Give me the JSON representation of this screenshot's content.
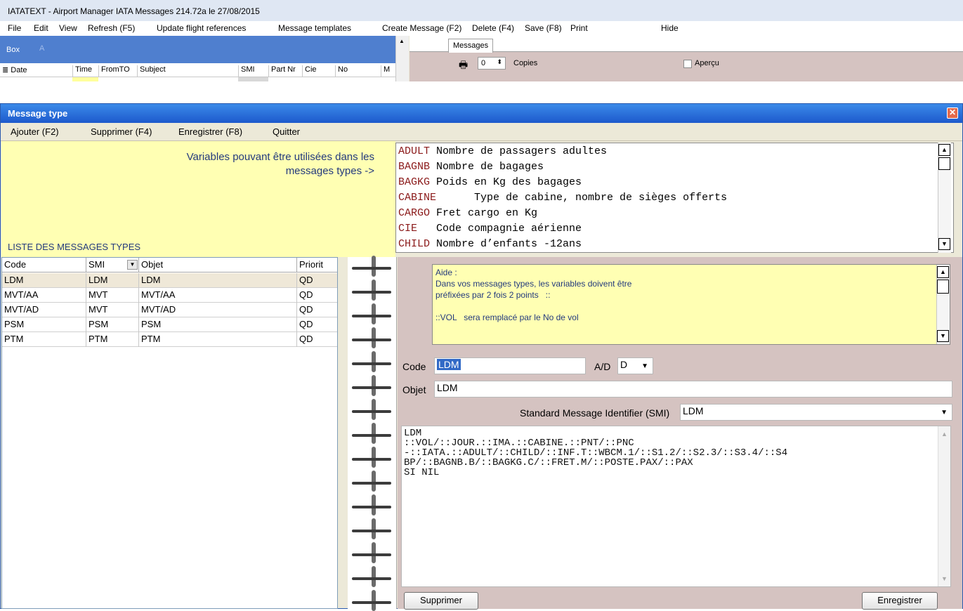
{
  "bg_app": {
    "title": "IATATEXT - Airport Manager IATA Messages 214.72a  le 27/08/2015",
    "menu": [
      "File",
      "Edit",
      "View",
      "Refresh (F5)",
      "Update flight references",
      "Message templates",
      "Create Message (F2)",
      "Delete (F4)",
      "Save (F8)",
      "Print",
      "Hide"
    ],
    "box_label": "Box",
    "box_sort": "A",
    "columns": [
      "Date",
      "Time",
      "FromTO",
      "Subject",
      "SMI",
      "Part Nr",
      "Cie",
      "No",
      "M"
    ],
    "messages_tab": "Messages",
    "copies_value": "0",
    "copies_label": "Copies",
    "apercu_label": "Aperçu"
  },
  "dialog": {
    "title": "Message type",
    "close_glyph": "✕",
    "menu": [
      "Ajouter (F2)",
      "Supprimer (F4)",
      "Enregistrer (F8)",
      "Quitter"
    ],
    "variables_hint": "Variables pouvant être utilisées dans les messages types ->",
    "list_heading": "LISTE DES MESSAGES TYPES",
    "variables": [
      {
        "name": "ADULT",
        "desc": " Nombre de passagers adultes"
      },
      {
        "name": "BAGNB",
        "desc": " Nombre de bagages"
      },
      {
        "name": "BAGKG",
        "desc": " Poids en Kg des bagages"
      },
      {
        "name": "CABINE",
        "desc": "      Type de cabine, nombre de sièges offerts"
      },
      {
        "name": "CARGO",
        "desc": " Fret cargo en Kg"
      },
      {
        "name": "CIE",
        "desc": "   Code compagnie aérienne"
      },
      {
        "name": "CHILD",
        "desc": " Nombre d’enfants -12ans"
      }
    ],
    "grid": {
      "headers": [
        "Code",
        "SMI",
        "Objet",
        "Priorit"
      ],
      "rows": [
        [
          "LDM",
          "LDM",
          "LDM",
          "QD"
        ],
        [
          "MVT/AA",
          "MVT",
          "MVT/AA",
          "QD"
        ],
        [
          "MVT/AD",
          "MVT",
          "MVT/AD",
          "QD"
        ],
        [
          "PSM",
          "PSM",
          "PSM",
          "QD"
        ],
        [
          "PTM",
          "PTM",
          "PTM",
          "QD"
        ]
      ]
    },
    "help_text": "Aide :\nDans vos messages types, les variables doivent être\npréfixées par 2 fois 2 points   ::\n\n::VOL   sera remplacé par le No de vol",
    "form": {
      "code_label": "Code",
      "code_value": "LDM",
      "ad_label": "A/D",
      "ad_value": "D",
      "objet_label": "Objet",
      "objet_value": "LDM",
      "smi_label": "Standard Message Identifier (SMI)",
      "smi_value": "LDM",
      "body": "LDM\n::VOL/::JOUR.::IMA.::CABINE.::PNT/::PNC\n-::IATA.::ADULT/::CHILD/::INF.T::WBCM.1/::S1.2/::S2.3/::S3.4/::S4\nBP/::BAGNB.B/::BAGKG.C/::FRET.M/::POSTE.PAX/::PAX\nSI NIL"
    },
    "buttons": {
      "delete": "Supprimer",
      "save": "Enregistrer"
    }
  }
}
